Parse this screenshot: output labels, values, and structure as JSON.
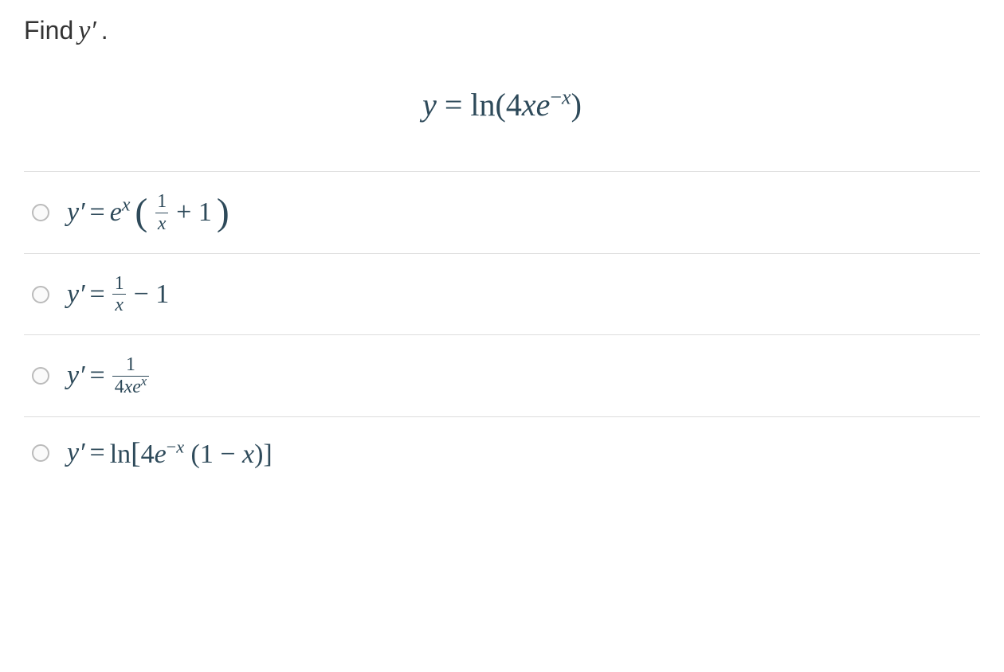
{
  "question": {
    "prompt_text": "Find ",
    "prompt_var": "y′",
    "prompt_end": "."
  },
  "equation": {
    "lhs": "y",
    "eq": " = ",
    "rhs_prefix": "ln(4",
    "rhs_x": "x",
    "rhs_e": "e",
    "rhs_exp_minus": "−",
    "rhs_exp_x": "x",
    "rhs_suffix": ")"
  },
  "options": [
    {
      "id": "opt-a",
      "yprime": "y′",
      "eq": " = ",
      "e": "e",
      "exp_x": "x",
      "lparen": "(",
      "frac_num": "1",
      "frac_den": "x",
      "plus": " + 1",
      "rparen": ")"
    },
    {
      "id": "opt-b",
      "yprime": "y′",
      "eq": " = ",
      "frac_num": "1",
      "frac_den": "x",
      "minus": " − 1"
    },
    {
      "id": "opt-c",
      "yprime": "y′",
      "eq": " = ",
      "frac_num": "1",
      "frac_den_4": "4",
      "frac_den_x": "x",
      "frac_den_e": "e",
      "frac_den_exp": "x"
    },
    {
      "id": "opt-d",
      "yprime": "y′",
      "eq": " = ",
      "ln": "ln",
      "lbracket": "[",
      "four": "4",
      "e": "e",
      "exp_minus": "−",
      "exp_x": "x",
      "space_lparen": " (1 − ",
      "x2": "x",
      "rparen_rbracket": ")]"
    }
  ]
}
